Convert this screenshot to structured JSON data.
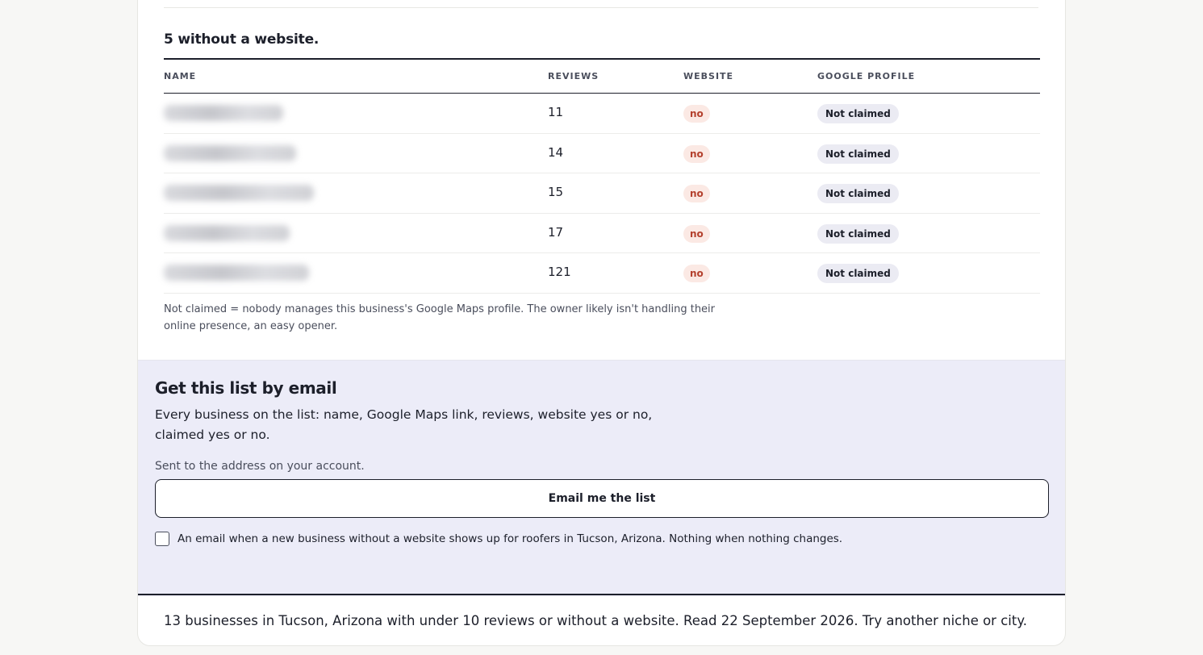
{
  "section": {
    "title": "5 without a website."
  },
  "table": {
    "headers": {
      "name": "NAME",
      "reviews": "REVIEWS",
      "website": "WEBSITE",
      "google_profile": "GOOGLE PROFILE"
    },
    "rows": [
      {
        "reviews": "11",
        "website": "no",
        "google_profile": "Not claimed"
      },
      {
        "reviews": "14",
        "website": "no",
        "google_profile": "Not claimed"
      },
      {
        "reviews": "15",
        "website": "no",
        "google_profile": "Not claimed"
      },
      {
        "reviews": "17",
        "website": "no",
        "google_profile": "Not claimed"
      },
      {
        "reviews": "121",
        "website": "no",
        "google_profile": "Not claimed"
      }
    ],
    "footnote": "Not claimed = nobody manages this business's Google Maps profile. The owner likely isn't handling their online presence, an easy opener."
  },
  "email_panel": {
    "title": "Get this list by email",
    "description": "Every business on the list: name, Google Maps link, reviews, website yes or no, claimed yes or no.",
    "sub": "Sent to the address on your account.",
    "button_label": "Email me the list",
    "alert_label": "An email when a new business without a website shows up for roofers in Tucson, Arizona. Nothing when nothing changes.",
    "alert_checked": false
  },
  "footer": {
    "text": "13 businesses in Tucson, Arizona with under 10 reviews or without a website. Read 22 September 2026. Try another niche or city."
  },
  "colors": {
    "panel_bg": "#ececf8",
    "badge_no_bg": "#fbe9e4",
    "badge_no_text": "#b4412e",
    "badge_claim_bg": "#ebebf3",
    "text_dark": "#1c1f2a"
  }
}
